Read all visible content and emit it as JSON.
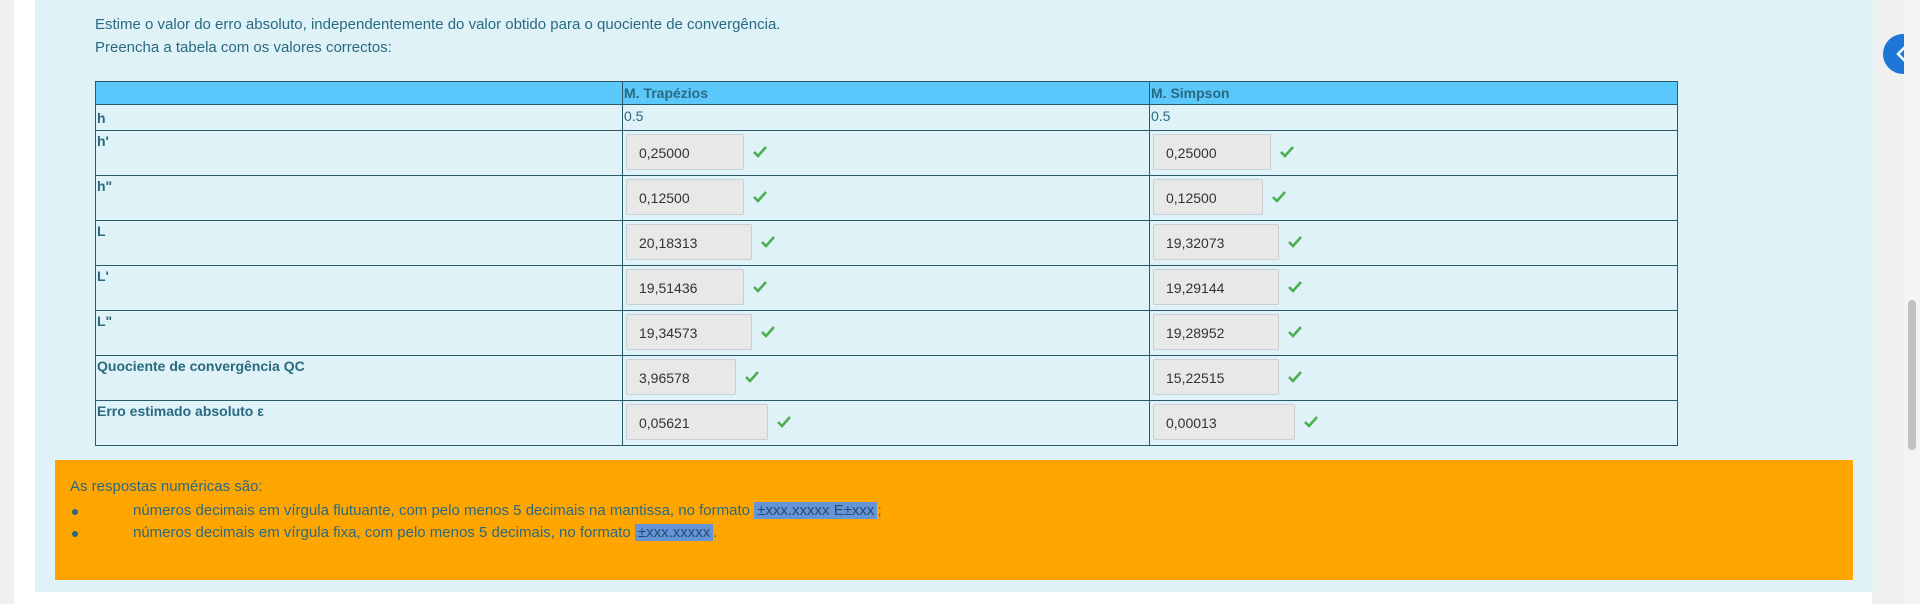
{
  "instructions": {
    "line1": "Estime o valor do erro absoluto, independentemente do valor obtido para o quociente de convergência.",
    "line2": "Preencha a tabela com os valores correctos:"
  },
  "table": {
    "headers": [
      "",
      "M. Trapézios",
      "M. Simpson"
    ],
    "h_row": {
      "label": "h",
      "trap": "0.5",
      "simp": "0.5"
    },
    "rows": [
      {
        "label": "h'",
        "trap": "0,25000",
        "simp": "0,25000"
      },
      {
        "label": "h\"",
        "trap": "0,12500",
        "simp": "0,12500"
      },
      {
        "label": "L",
        "trap": "20,18313",
        "simp": "19,32073"
      },
      {
        "label": "L'",
        "trap": "19,51436",
        "simp": "19,29144"
      },
      {
        "label": "L\"",
        "trap": "19,34573",
        "simp": "19,28952"
      },
      {
        "label": "Quociente de convergência QC",
        "trap": "3,96578",
        "simp": "15,22515"
      },
      {
        "label": "Erro estimado absoluto ε",
        "trap": "0,05621",
        "simp": "0,00013"
      }
    ]
  },
  "note": {
    "heading": "As respostas numéricas são:",
    "items": [
      {
        "text": "números decimais em vírgula flutuante, com pelo menos 5 decimais na mantissa, no formato ",
        "format": "±xxx.xxxxx  E±xxx",
        "end": ";"
      },
      {
        "text": "números decimais em vírgula fixa, com pelo menos 5 decimais, no formato ",
        "format": "±xxx.xxxxx",
        "end": "."
      }
    ]
  },
  "colors": {
    "panel_bg": "#def2f8",
    "header_bg": "#5ac8fb",
    "note_bg": "#ffa500",
    "check": "#4caf50",
    "side_tab": "#1e77d6"
  },
  "icons": [
    "check-icon",
    "chevron-left-icon"
  ]
}
